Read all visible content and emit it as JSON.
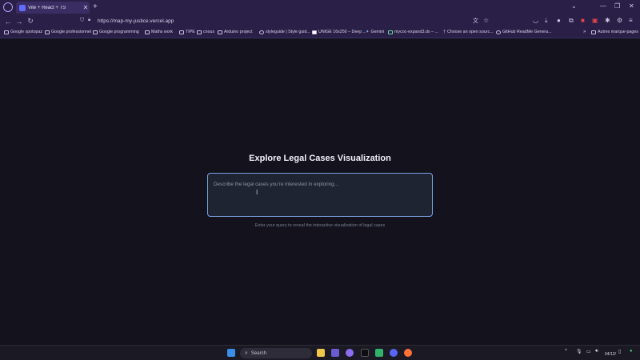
{
  "browser": {
    "tab_title": "Vite + React + TS",
    "url": "https://map-my-justice.vercel.app",
    "bookmarks": [
      "Google spotopaz",
      "Google professionnel",
      "Google programming",
      "Maths work",
      "TIPE",
      "cnous",
      "Arduino project",
      "styleguide | Style guid...",
      "UNIGE 16x250 – Deep ...",
      "Gemini",
      "mycoc-expand3.dx – ...",
      "Choose an open sourc...",
      "GitHub ReadMe Genera...",
      "Autres marque-pages"
    ]
  },
  "page": {
    "heading": "Explore Legal Cases Visualization",
    "query_placeholder": "Describe the legal cases you're interested in exploring...",
    "hint": "Enter your query to reveal the interactive visualization of legal cases"
  },
  "taskbar": {
    "search_label": "Search",
    "date": "04/12/"
  },
  "colors": {
    "accent_border": "#7aa2e0",
    "background": "#14121d",
    "browser_chrome": "#2a1f47"
  }
}
